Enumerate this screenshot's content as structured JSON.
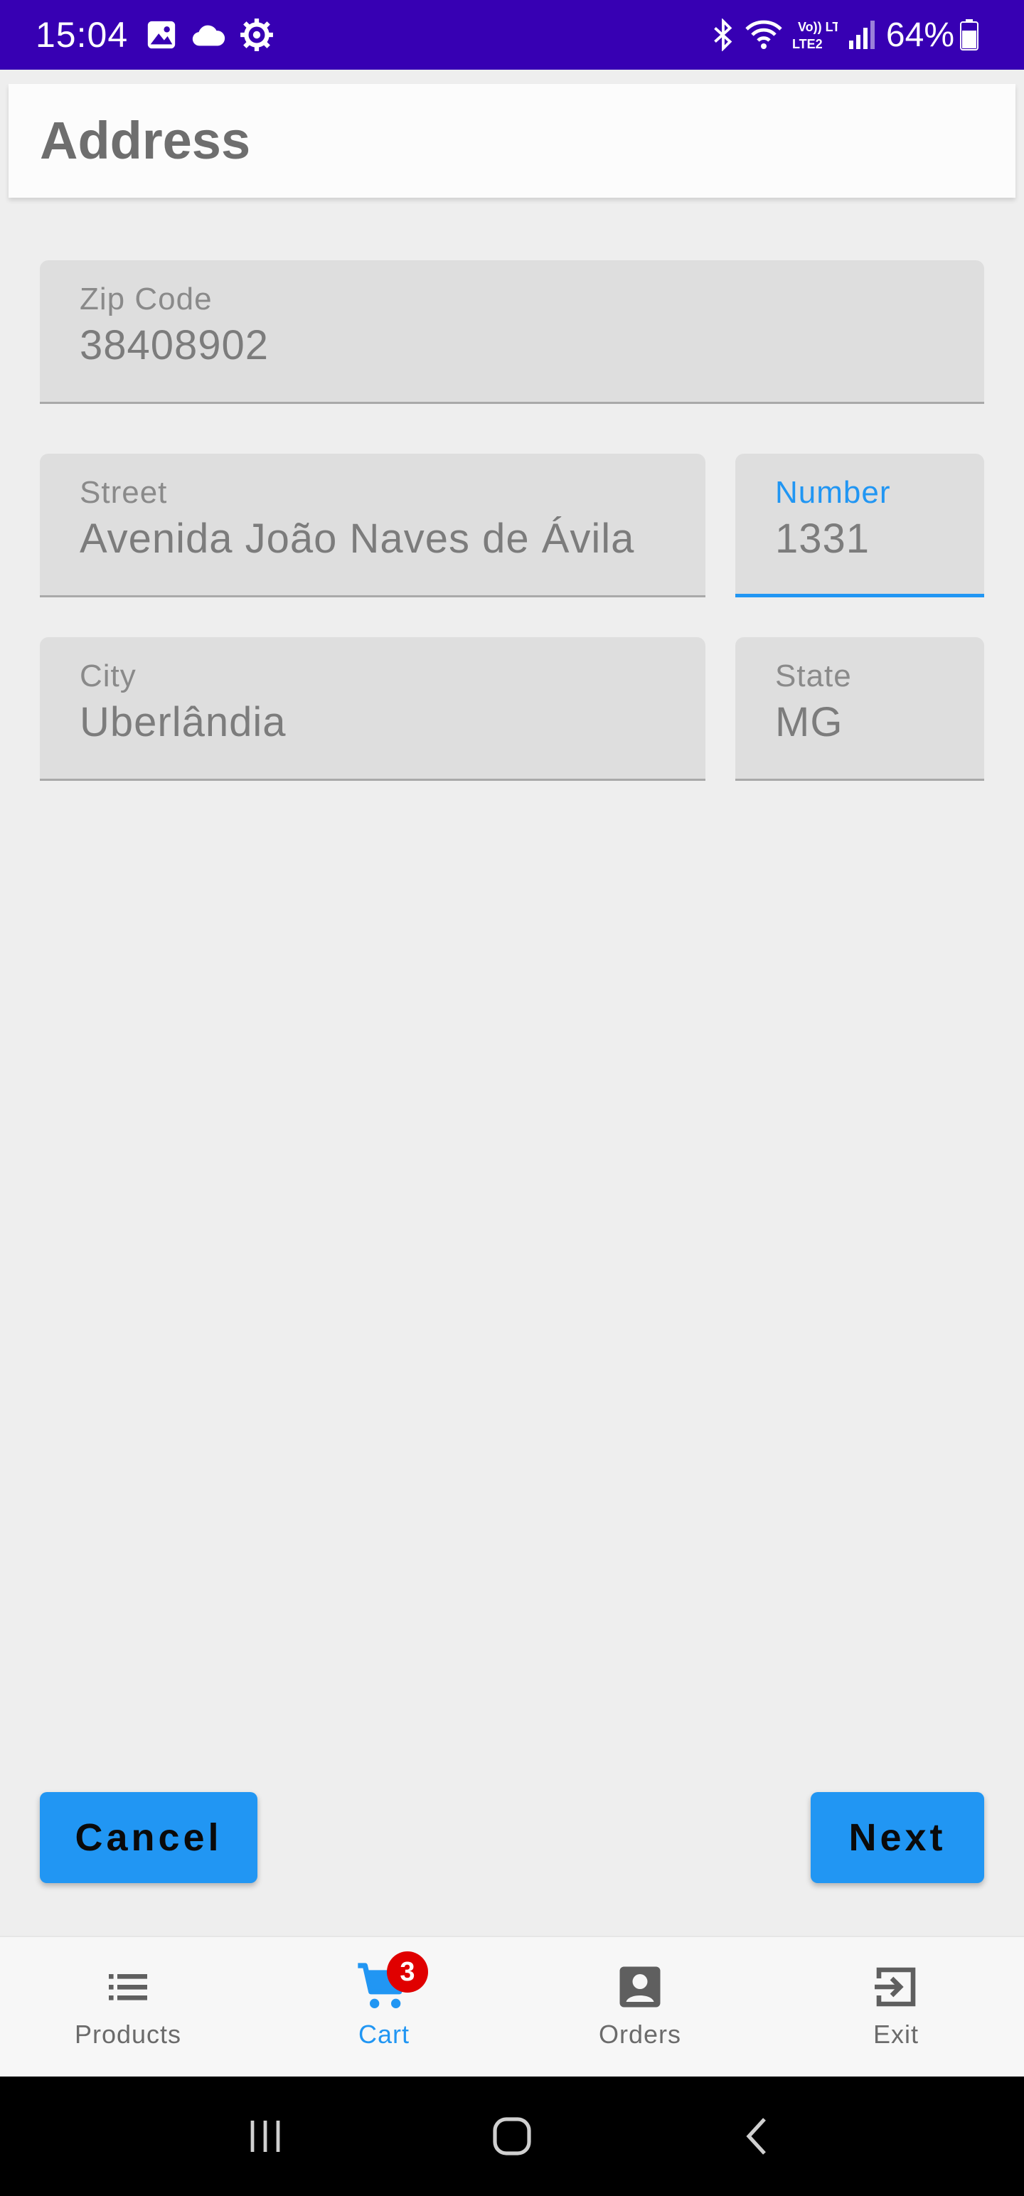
{
  "status_bar": {
    "time": "15:04",
    "battery_text": "64%",
    "left_icons": [
      "gallery-icon",
      "cloud-icon",
      "settings-gear-icon"
    ],
    "right_icons": [
      "bluetooth-icon",
      "wifi-icon",
      "volte-icon",
      "signal-icon",
      "battery-icon"
    ],
    "volte_text": "Vo)) LTE2",
    "background_color": "#3700b3"
  },
  "app_bar": {
    "title": "Address"
  },
  "form": {
    "zip": {
      "label": "Zip Code",
      "value": "38408902"
    },
    "street": {
      "label": "Street",
      "value": "Avenida João Naves de Ávila"
    },
    "number": {
      "label": "Number",
      "value": "1331",
      "focused": true
    },
    "city": {
      "label": "City",
      "value": "Uberlândia"
    },
    "state": {
      "label": "State",
      "value": "MG"
    }
  },
  "actions": {
    "cancel_label": "Cancel",
    "next_label": "Next",
    "button_color": "#2196f3"
  },
  "bottom_nav": {
    "items": [
      {
        "label": "Products",
        "icon": "list-icon",
        "active": false
      },
      {
        "label": "Cart",
        "icon": "cart-icon",
        "active": true,
        "badge": "3"
      },
      {
        "label": "Orders",
        "icon": "account-box-icon",
        "active": false
      },
      {
        "label": "Exit",
        "icon": "exit-icon",
        "active": false
      }
    ],
    "active_color": "#2196f3",
    "badge_color": "#e00000"
  },
  "system_nav": {
    "buttons": [
      "recents-icon",
      "home-icon",
      "back-icon"
    ]
  }
}
